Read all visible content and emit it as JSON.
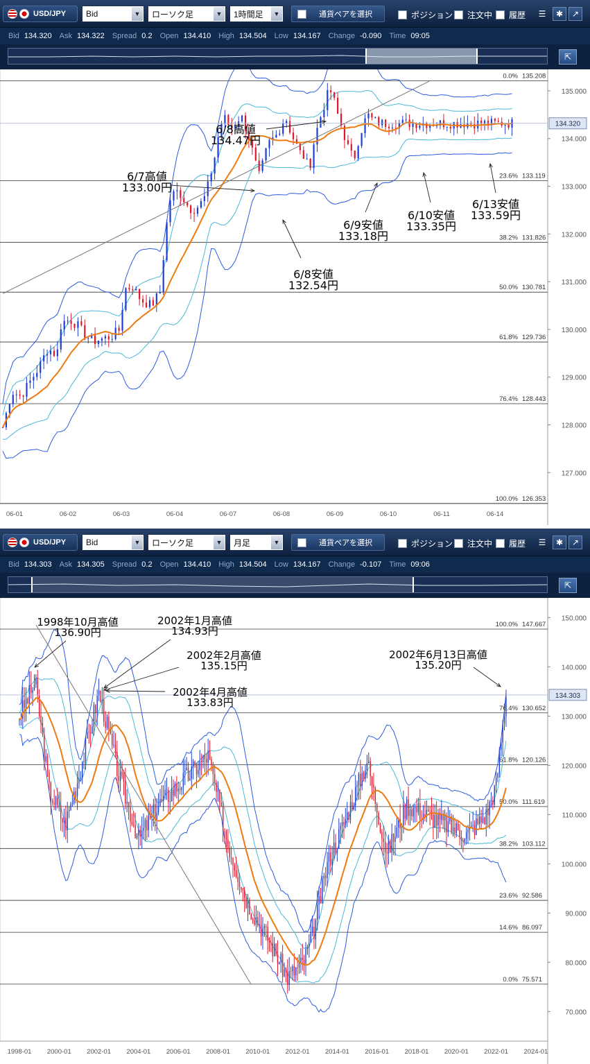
{
  "colors": {
    "toolbar": "#0d2140",
    "candle_up": "#1f3fd0",
    "candle_down": "#e0182b",
    "ma": "#ee7a10",
    "band_outer": "#2a5ae0",
    "band_inner": "#4ab8d8"
  },
  "toolbar": {
    "pair": "USD/JPY",
    "icons": {
      "pair": "us-jp-flag-icon",
      "menu": "menu-icon",
      "settings": "gear-icon",
      "popout": "popout-arrow-icon",
      "nav": "expand-icon"
    },
    "price_type": "Bid",
    "chart_type": "ローソク足",
    "select_pair_label": "通貨ペアを選択",
    "toggles": [
      "ポジション",
      "注文中",
      "履歴"
    ]
  },
  "charts": [
    {
      "interval": "1時間足",
      "quote": {
        "Bid": "134.320",
        "Ask": "134.322",
        "Spread": "0.2",
        "Open": "134.410",
        "High": "134.504",
        "Low": "134.167",
        "Change": "-0.090",
        "Time": "09:05"
      },
      "price_tag": "134.320"
    },
    {
      "interval": "月足",
      "quote": {
        "Bid": "134.303",
        "Ask": "134.305",
        "Spread": "0.2",
        "Open": "134.410",
        "High": "134.504",
        "Low": "134.167",
        "Change": "-0.107",
        "Time": "09:06"
      },
      "price_tag": "134.303"
    }
  ],
  "chart_data": [
    {
      "type": "candlestick",
      "title": "",
      "x_ticks": [
        "06-01",
        "06-02",
        "06-03",
        "06-04",
        "06-07",
        "06-08",
        "06-09",
        "06-10",
        "06-11",
        "06-14"
      ],
      "y_ticks": [
        "135.000",
        "134.000",
        "133.000",
        "132.000",
        "131.000",
        "130.000",
        "129.000",
        "128.000",
        "127.000"
      ],
      "ylim": [
        126.35,
        135.45
      ],
      "last_price": 134.32,
      "series": [
        {
          "name": "",
          "note": "close path (hourly)",
          "x": [
            0,
            2,
            4,
            6,
            8,
            10,
            12,
            13,
            15,
            17,
            18,
            20,
            22,
            24,
            26,
            27,
            29,
            30,
            31,
            33,
            35,
            36,
            37,
            38,
            39,
            40,
            41,
            42,
            43,
            44,
            45,
            46,
            47,
            48,
            49,
            50,
            51,
            52,
            53,
            54,
            55,
            56,
            57,
            58,
            59,
            60,
            61,
            62,
            63,
            64,
            65,
            66,
            67,
            68,
            69,
            70,
            71,
            72,
            73,
            74,
            75,
            76,
            77,
            78,
            79,
            80,
            81,
            82,
            83,
            84,
            85,
            86,
            87,
            88,
            89,
            90,
            91,
            92,
            93,
            94,
            95,
            96,
            97,
            98,
            99,
            100,
            101,
            102,
            103,
            104,
            105,
            106,
            107,
            108,
            109,
            110,
            111,
            112,
            113,
            114
          ],
          "close": [
            127.95,
            128.7,
            128.6,
            128.9,
            129.2,
            129.6,
            129.45,
            130.15,
            130.2,
            130.05,
            129.9,
            129.75,
            129.8,
            129.85,
            130.0,
            130.85,
            130.9,
            130.7,
            130.6,
            130.5,
            130.8,
            131.9,
            132.7,
            132.85,
            132.9,
            132.75,
            132.6,
            132.5,
            132.55,
            132.65,
            132.8,
            133.2,
            133.6,
            134.15,
            134.47,
            134.3,
            134.2,
            134.4,
            134.45,
            134.2,
            133.9,
            133.5,
            133.18,
            133.6,
            133.9,
            134.0,
            134.1,
            134.35,
            134.4,
            134.1,
            133.9,
            133.7,
            133.6,
            133.35,
            133.9,
            134.3,
            134.6,
            134.9,
            135.0,
            134.6,
            134.3,
            134.0,
            133.7,
            133.59,
            134.0,
            134.3,
            134.5,
            134.4,
            134.35,
            134.32,
            134.32,
            134.32,
            134.32,
            134.32,
            134.32,
            134.32,
            134.32,
            134.32,
            134.32,
            134.32,
            134.32,
            134.32,
            134.32,
            134.32,
            134.32,
            134.32,
            134.32,
            134.32,
            134.32,
            134.32,
            134.32,
            134.32,
            134.32,
            134.32,
            134.32,
            134.32,
            134.32,
            134.32,
            134.32,
            134.32
          ]
        }
      ],
      "fibonacci": [
        {
          "label": "0.0%",
          "value": "135.208"
        },
        {
          "label": "23.6%",
          "value": "133.119"
        },
        {
          "label": "38.2%",
          "value": "131.826"
        },
        {
          "label": "50.0%",
          "value": "130.781"
        },
        {
          "label": "61.8%",
          "value": "129.736"
        },
        {
          "label": "76.4%",
          "value": "128.443"
        },
        {
          "label": "100.0%",
          "value": "126.353"
        }
      ],
      "annotations": [
        {
          "line1": "6/8高値",
          "line2": "134.47円"
        },
        {
          "line1": "6/7高値",
          "line2": "133.00円"
        },
        {
          "line1": "6/8安値",
          "line2": "132.54円"
        },
        {
          "line1": "6/9安値",
          "line2": "133.18円"
        },
        {
          "line1": "6/10安値",
          "line2": "133.35円"
        },
        {
          "line1": "6/13安値",
          "line2": "133.59円"
        }
      ]
    },
    {
      "type": "candlestick",
      "title": "",
      "x_ticks": [
        "1998-01",
        "2000-01",
        "2002-01",
        "2004-01",
        "2006-01",
        "2008-01",
        "2010-01",
        "2012-01",
        "2014-01",
        "2016-01",
        "2018-01",
        "2020-01",
        "2022-01",
        "2024-01"
      ],
      "y_ticks": [
        "150.000",
        "140.000",
        "130.000",
        "120.000",
        "110.000",
        "100.000",
        "90.000",
        "80.000",
        "70.000"
      ],
      "ylim": [
        64.0,
        154.0
      ],
      "last_price": 134.303,
      "series": [
        {
          "name": "",
          "note": "monthly close path",
          "x": [
            1998.0,
            1998.8,
            1999.5,
            2000.3,
            2001.0,
            2002.0,
            2002.3,
            2003.0,
            2004.0,
            2005.0,
            2006.0,
            2007.0,
            2007.5,
            2008.5,
            2009.5,
            2010.5,
            2011.5,
            2012.3,
            2012.8,
            2013.5,
            2014.5,
            2015.5,
            2016.5,
            2017.5,
            2018.5,
            2019.5,
            2020.5,
            2021.5,
            2022.0,
            2022.5
          ],
          "close": [
            130,
            136.9,
            115,
            108,
            118,
            134.9,
            130,
            118,
            105,
            112,
            116,
            120,
            122,
            104,
            92,
            85,
            77,
            80,
            86,
            100,
            110,
            121,
            102,
            112,
            110,
            108,
            106,
            110,
            116,
            134.3
          ]
        }
      ],
      "fibonacci": [
        {
          "label": "100.0%",
          "value": "147.667"
        },
        {
          "label": "76.4%",
          "value": "130.652"
        },
        {
          "label": "61.8%",
          "value": "120.126"
        },
        {
          "label": "50.0%",
          "value": "111.619"
        },
        {
          "label": "38.2%",
          "value": "103.112"
        },
        {
          "label": "23.6%",
          "value": "92.586"
        },
        {
          "label": "14.6%",
          "value": "86.097"
        },
        {
          "label": "0.0%",
          "value": "75.571"
        }
      ],
      "annotations": [
        {
          "line1": "1998年10月高値",
          "line2": "136.90円"
        },
        {
          "line1": "2002年1月高値",
          "line2": "134.93円"
        },
        {
          "line1": "2002年2月高値",
          "line2": "135.15円"
        },
        {
          "line1": "2002年4月高値",
          "line2": "133.83円"
        },
        {
          "line1": "2002年6月13日高値",
          "line2": "135.20円"
        }
      ]
    }
  ]
}
